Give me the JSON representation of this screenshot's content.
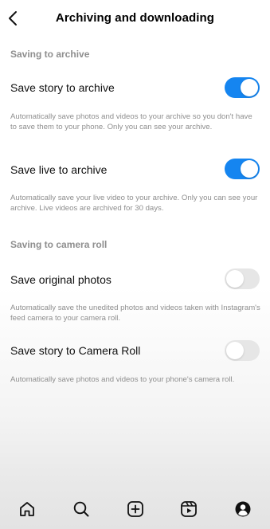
{
  "header": {
    "title": "Archiving and downloading",
    "back_icon": "chevron-left-icon"
  },
  "sections": {
    "archive": {
      "header": "Saving to archive",
      "items": [
        {
          "label": "Save story to archive",
          "enabled": true,
          "description": "Automatically save photos and videos to your archive so you don't have to save them to your phone. Only you can see your archive."
        },
        {
          "label": "Save live to archive",
          "enabled": true,
          "description": "Automatically save your live video to your archive. Only you can see your archive. Live videos are archived for 30 days."
        }
      ]
    },
    "camera_roll": {
      "header": "Saving to camera roll",
      "items": [
        {
          "label": "Save original photos",
          "enabled": false,
          "description": "Automatically save the unedited photos and videos taken with Instagram's feed camera to your camera roll."
        },
        {
          "label": "Save story to Camera Roll",
          "enabled": false,
          "description": "Automatically save photos and videos to your phone's camera roll."
        }
      ]
    }
  },
  "bottom_nav": {
    "items": [
      "home-icon",
      "search-icon",
      "create-icon",
      "reels-icon",
      "profile-icon"
    ]
  },
  "colors": {
    "toggle_on": "#1585f0",
    "toggle_off": "#e6e6e6",
    "secondary_text": "#8e8e8e"
  }
}
